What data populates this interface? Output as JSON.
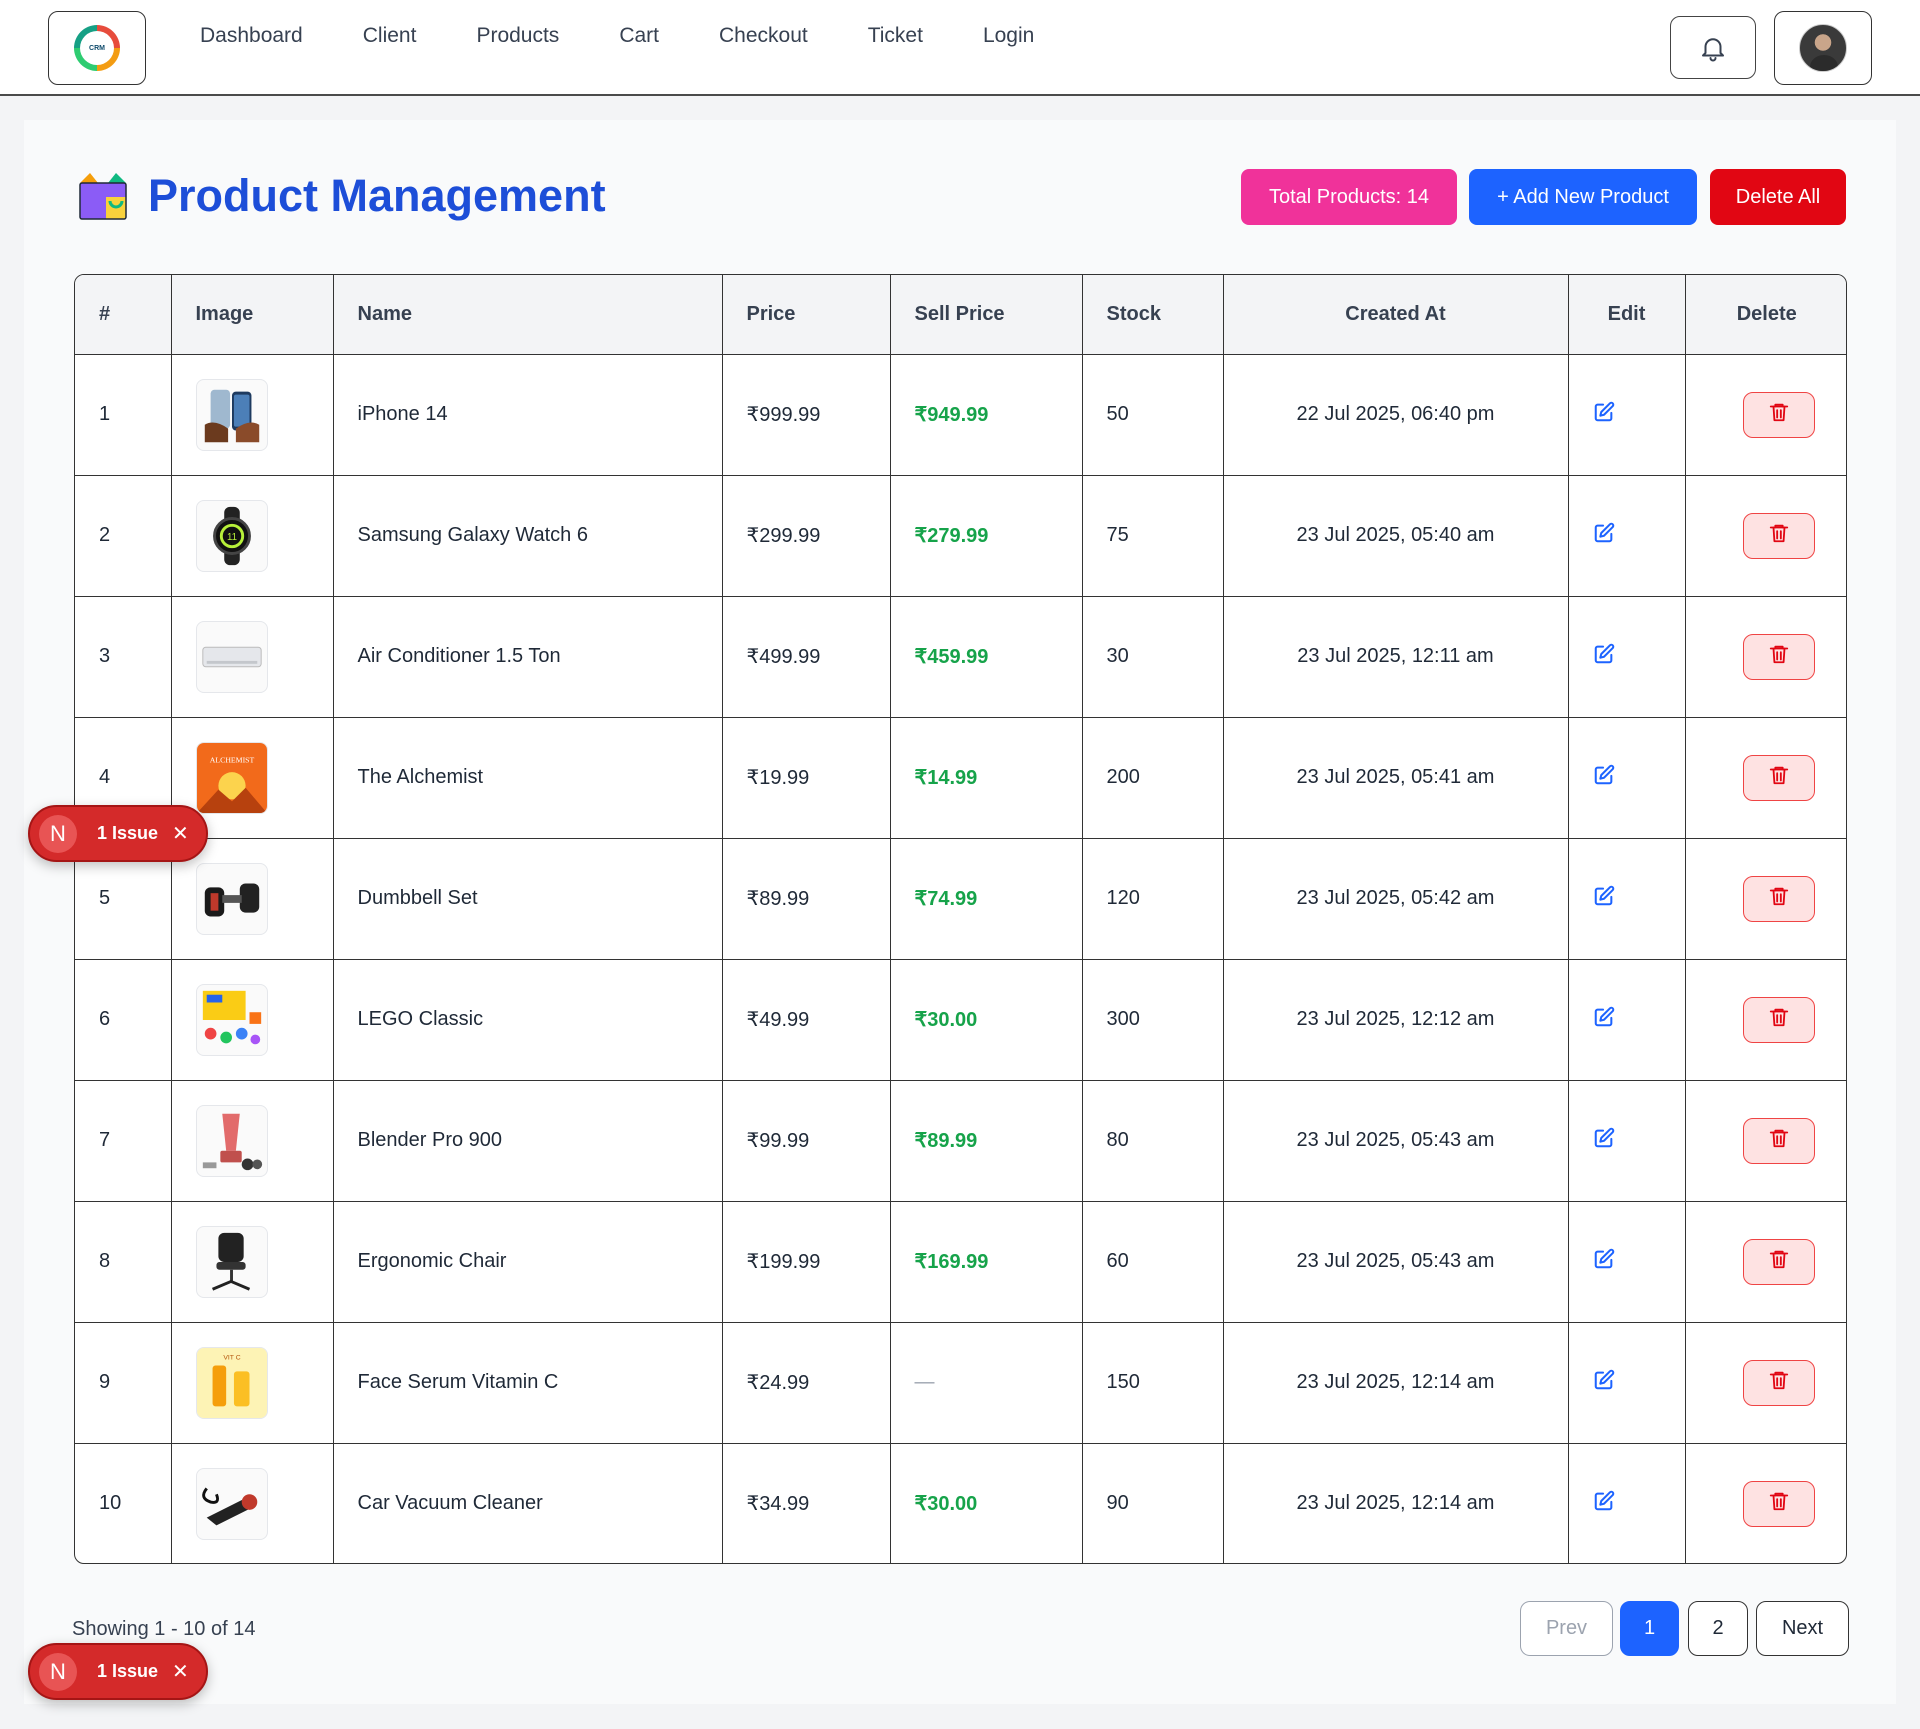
{
  "nav": {
    "logo_text": "CRM",
    "links": [
      "Dashboard",
      "Client",
      "Products",
      "Cart",
      "Checkout",
      "Ticket",
      "Login"
    ]
  },
  "page": {
    "title": "Product Management",
    "total_label": "Total Products: 14",
    "add_label": "+ Add New Product",
    "delete_all_label": "Delete All"
  },
  "table": {
    "headers": [
      "#",
      "Image",
      "Name",
      "Price",
      "Sell Price",
      "Stock",
      "Created At",
      "Edit",
      "Delete"
    ],
    "rows": [
      {
        "num": "1",
        "name": "iPhone 14",
        "price": "₹999.99",
        "sell": "₹949.99",
        "stock": "50",
        "created": "22 Jul 2025, 06:40 pm",
        "img": "phone"
      },
      {
        "num": "2",
        "name": "Samsung Galaxy Watch 6",
        "price": "₹299.99",
        "sell": "₹279.99",
        "stock": "75",
        "created": "23 Jul 2025, 05:40 am",
        "img": "watch"
      },
      {
        "num": "3",
        "name": "Air Conditioner 1.5 Ton",
        "price": "₹499.99",
        "sell": "₹459.99",
        "stock": "30",
        "created": "23 Jul 2025, 12:11 am",
        "img": "ac"
      },
      {
        "num": "4",
        "name": "The Alchemist",
        "price": "₹19.99",
        "sell": "₹14.99",
        "stock": "200",
        "created": "23 Jul 2025, 05:41 am",
        "img": "book"
      },
      {
        "num": "5",
        "name": "Dumbbell Set",
        "price": "₹89.99",
        "sell": "₹74.99",
        "stock": "120",
        "created": "23 Jul 2025, 05:42 am",
        "img": "dumbbell"
      },
      {
        "num": "6",
        "name": "LEGO Classic",
        "price": "₹49.99",
        "sell": "₹30.00",
        "stock": "300",
        "created": "23 Jul 2025, 12:12 am",
        "img": "lego"
      },
      {
        "num": "7",
        "name": "Blender Pro 900",
        "price": "₹99.99",
        "sell": "₹89.99",
        "stock": "80",
        "created": "23 Jul 2025, 05:43 am",
        "img": "blender"
      },
      {
        "num": "8",
        "name": "Ergonomic Chair",
        "price": "₹199.99",
        "sell": "₹169.99",
        "stock": "60",
        "created": "23 Jul 2025, 05:43 am",
        "img": "chair"
      },
      {
        "num": "9",
        "name": "Face Serum Vitamin C",
        "price": "₹24.99",
        "sell": "—",
        "stock": "150",
        "created": "23 Jul 2025, 12:14 am",
        "img": "serum"
      },
      {
        "num": "10",
        "name": "Car Vacuum Cleaner",
        "price": "₹34.99",
        "sell": "₹30.00",
        "stock": "90",
        "created": "23 Jul 2025, 12:14 am",
        "img": "vacuum"
      }
    ]
  },
  "footer": {
    "showing": "Showing 1 - 10 of 14",
    "prev": "Prev",
    "pages": [
      "1",
      "2"
    ],
    "next": "Next"
  },
  "issues": {
    "letter": "N",
    "label": "1 Issue",
    "close": "✕"
  },
  "colors": {
    "accent": "#1d63ff",
    "title": "#1d4ed8",
    "total": "#f0329a",
    "danger": "#e10613",
    "sell": "#16a34a"
  }
}
